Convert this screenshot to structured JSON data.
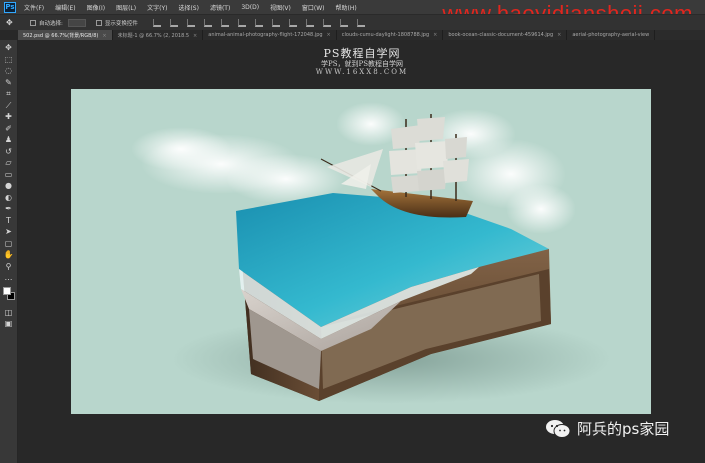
{
  "app": {
    "logo": "Ps",
    "menu": [
      "文件(F)",
      "编辑(E)",
      "图像(I)",
      "图层(L)",
      "文字(Y)",
      "选择(S)",
      "滤镜(T)",
      "3D(D)",
      "视图(V)",
      "窗口(W)",
      "帮助(H)"
    ],
    "watermark": "www.haoyidiansheji.com"
  },
  "options_bar": {
    "auto_select_label": "自动选择:",
    "transform_label": "显示变换控件"
  },
  "tabs": [
    {
      "label": "502.psd @ 66.7%(背景/RGB/8)",
      "active": true
    },
    {
      "label": "未标题-1 @ 66.7% (2, 2018.5"
    },
    {
      "label": "animal-animal-photography-flight-172048.jpg"
    },
    {
      "label": "clouds-cumu-daylight-1808788.jpg"
    },
    {
      "label": "book-ocean-classic-document-459614.jpg"
    },
    {
      "label": "aerial-photography-aerial-view"
    }
  ],
  "tools": [
    {
      "icon": "move-tool-icon",
      "glyph": "✥"
    },
    {
      "icon": "marquee-tool-icon",
      "glyph": "⬚"
    },
    {
      "icon": "lasso-tool-icon",
      "glyph": "◌"
    },
    {
      "icon": "quick-select-icon",
      "glyph": "✎"
    },
    {
      "icon": "crop-tool-icon",
      "glyph": "⌗"
    },
    {
      "icon": "eyedropper-icon",
      "glyph": "⟋"
    },
    {
      "icon": "healing-brush-icon",
      "glyph": "✚"
    },
    {
      "icon": "brush-tool-icon",
      "glyph": "✐"
    },
    {
      "icon": "clone-stamp-icon",
      "glyph": "♟"
    },
    {
      "icon": "history-brush-icon",
      "glyph": "↺"
    },
    {
      "icon": "eraser-icon",
      "glyph": "▱"
    },
    {
      "icon": "gradient-tool-icon",
      "glyph": "▭"
    },
    {
      "icon": "blur-tool-icon",
      "glyph": "●"
    },
    {
      "icon": "dodge-tool-icon",
      "glyph": "◐"
    },
    {
      "icon": "pen-tool-icon",
      "glyph": "✒"
    },
    {
      "icon": "type-tool-icon",
      "glyph": "T"
    },
    {
      "icon": "path-select-icon",
      "glyph": "➤"
    },
    {
      "icon": "shape-tool-icon",
      "glyph": "▢"
    },
    {
      "icon": "hand-tool-icon",
      "glyph": "✋"
    },
    {
      "icon": "zoom-tool-icon",
      "glyph": "⚲"
    },
    {
      "icon": "more-tools-icon",
      "glyph": "…"
    }
  ],
  "extra_tools": [
    {
      "icon": "quick-mask-icon",
      "glyph": "◫"
    },
    {
      "icon": "screen-mode-icon",
      "glyph": "▣"
    }
  ],
  "canvas_header": {
    "title": "PS教程自学网",
    "subtitle": "学PS，就到PS教程自学网",
    "url": "WWW.16XX8.COM"
  },
  "footer_watermark": {
    "text": "阿兵的ps家园"
  },
  "colors": {
    "accent": "#31a8ff",
    "watermark_red": "#e0261e",
    "canvas_bg": "#b8d6cc",
    "foreground_swatch": "#ffffff",
    "background_swatch": "#000000"
  }
}
